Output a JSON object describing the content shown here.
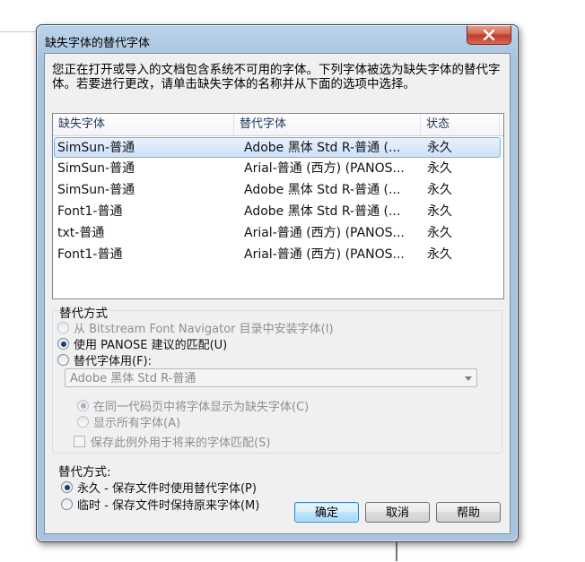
{
  "window": {
    "title": "缺失字体的替代字体"
  },
  "description": "您正在打开或导入的文档包含系统不可用的字体。下列字体被选为缺失字体的替代字体。若要进行更改，请单击缺失字体的名称并从下面的选项中选择。",
  "table": {
    "headers": [
      "缺失字体",
      "替代字体",
      "状态"
    ],
    "rows": [
      {
        "missing": "SimSun-普通",
        "substitute": "Adobe 黑体 Std R-普通 (...",
        "status": "永久",
        "selected": true
      },
      {
        "missing": "SimSun-普通",
        "substitute": "Arial-普通 (西方) (PANOS...",
        "status": "永久"
      },
      {
        "missing": "SimSun-普通",
        "substitute": "Adobe 黑体 Std R-普通 (...",
        "status": "永久"
      },
      {
        "missing": "Font1-普通",
        "substitute": "Adobe 黑体 Std R-普通 (...",
        "status": "永久"
      },
      {
        "missing": "txt-普通",
        "substitute": "Arial-普通 (西方) (PANOS...",
        "status": "永久"
      },
      {
        "missing": "Font1-普通",
        "substitute": "Arial-普通 (西方) (PANOS...",
        "status": "永久"
      }
    ]
  },
  "substitution_group": {
    "label": "替代方式",
    "options": [
      {
        "label": "从 Bitstream Font Navigator 目录中安装字体(I)",
        "checked": false,
        "disabled": true
      },
      {
        "label": "使用 PANOSE 建议的匹配(U)",
        "checked": true,
        "disabled": false
      },
      {
        "label": "替代字体用(F):",
        "checked": false,
        "disabled": false
      }
    ],
    "font_select": "Adobe 黑体 Std R-普通",
    "sub_options": [
      {
        "label": "在同一代码页中将字体显示为缺失字体(C)",
        "checked": true
      },
      {
        "label": "显示所有字体(A)",
        "checked": false
      }
    ],
    "save_exception": "保存此例外用于将来的字体匹配(S)"
  },
  "mode_group": {
    "label": "替代方式:",
    "options": [
      {
        "label": "永久 - 保存文件时使用替代字体(P)",
        "checked": true
      },
      {
        "label": "临时 - 保存文件时保持原来字体(M)",
        "checked": false
      }
    ]
  },
  "buttons": {
    "ok": "确定",
    "cancel": "取消",
    "help": "帮助"
  }
}
